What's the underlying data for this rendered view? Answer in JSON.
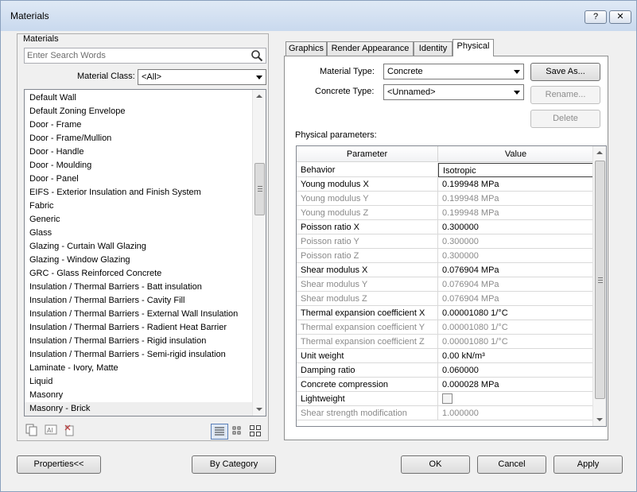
{
  "window": {
    "title": "Materials",
    "help_label": "?",
    "close_label": "✕"
  },
  "left": {
    "group_label": "Materials",
    "search": {
      "placeholder": "Enter Search Words"
    },
    "class_label": "Material Class:",
    "class_value": "<All>",
    "items": [
      "Default Wall",
      "Default Zoning Envelope",
      "Door - Frame",
      "Door - Frame/Mullion",
      "Door - Handle",
      "Door - Moulding",
      "Door - Panel",
      "EIFS - Exterior Insulation and Finish System",
      "Fabric",
      "Generic",
      "Glass",
      "Glazing - Curtain Wall Glazing",
      "Glazing - Window Glazing",
      "GRC -  Glass Reinforced Concrete",
      "Insulation / Thermal Barriers - Batt insulation",
      "Insulation / Thermal Barriers - Cavity Fill",
      "Insulation / Thermal Barriers - External Wall Insulation",
      "Insulation / Thermal Barriers - Radient Heat Barrier",
      "Insulation / Thermal Barriers - Rigid insulation",
      "Insulation / Thermal Barriers - Semi-rigid insulation",
      "Laminate - Ivory, Matte",
      "Liquid",
      "Masonry",
      "Masonry - Brick"
    ]
  },
  "tabs": [
    "Graphics",
    "Render Appearance",
    "Identity",
    "Physical"
  ],
  "physical": {
    "material_type_label": "Material Type:",
    "material_type_value": "Concrete",
    "concrete_type_label": "Concrete Type:",
    "concrete_type_value": "<Unnamed>",
    "save_as_label": "Save As...",
    "rename_label": "Rename...",
    "delete_label": "Delete",
    "params_label": "Physical parameters:",
    "col_parameter": "Parameter",
    "col_value": "Value",
    "rows": [
      {
        "param": "Behavior",
        "value": "Isotropic",
        "dim": false
      },
      {
        "param": "Young modulus X",
        "value": "0.199948 MPa",
        "dim": false
      },
      {
        "param": "Young modulus Y",
        "value": "0.199948 MPa",
        "dim": true
      },
      {
        "param": "Young modulus Z",
        "value": "0.199948 MPa",
        "dim": true
      },
      {
        "param": "Poisson ratio X",
        "value": "0.300000",
        "dim": false
      },
      {
        "param": "Poisson ratio Y",
        "value": "0.300000",
        "dim": true
      },
      {
        "param": "Poisson ratio Z",
        "value": "0.300000",
        "dim": true
      },
      {
        "param": "Shear modulus X",
        "value": "0.076904 MPa",
        "dim": false
      },
      {
        "param": "Shear modulus Y",
        "value": "0.076904 MPa",
        "dim": true
      },
      {
        "param": "Shear modulus Z",
        "value": "0.076904 MPa",
        "dim": true
      },
      {
        "param": "Thermal expansion coefficient X",
        "value": "0.00001080 1/°C",
        "dim": false
      },
      {
        "param": "Thermal expansion coefficient Y",
        "value": "0.00001080 1/°C",
        "dim": true
      },
      {
        "param": "Thermal expansion coefficient Z",
        "value": "0.00001080 1/°C",
        "dim": true
      },
      {
        "param": "Unit weight",
        "value": "0.00 kN/m³",
        "dim": false
      },
      {
        "param": "Damping ratio",
        "value": "0.060000",
        "dim": false
      },
      {
        "param": "Concrete compression",
        "value": "0.000028 MPa",
        "dim": false
      },
      {
        "param": "Lightweight",
        "value": "",
        "dim": false,
        "checkbox": true
      },
      {
        "param": "Shear strength modification",
        "value": "1.000000",
        "dim": true
      }
    ]
  },
  "footer": {
    "properties_label": "Properties<<",
    "by_category_label": "By Category",
    "ok_label": "OK",
    "cancel_label": "Cancel",
    "apply_label": "Apply"
  }
}
